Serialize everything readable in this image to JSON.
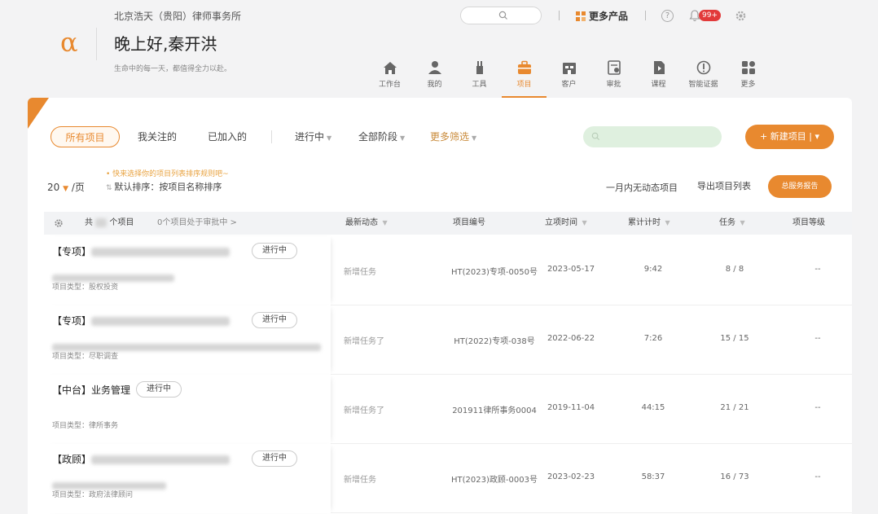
{
  "header": {
    "org": "北京浩天（贵阳）律师事务所",
    "logo": "α",
    "greeting": "晚上好,秦开洪",
    "motto": "生命中的每一天，都值得全力以赴。",
    "more_products": "更多产品",
    "help": "?",
    "notif_count": "99+"
  },
  "nav": [
    {
      "label": "工作台",
      "icon": "home-icon"
    },
    {
      "label": "我的",
      "icon": "user-icon"
    },
    {
      "label": "工具",
      "icon": "tools-icon"
    },
    {
      "label": "项目",
      "icon": "briefcase-icon"
    },
    {
      "label": "客户",
      "icon": "client-icon"
    },
    {
      "label": "审批",
      "icon": "approval-icon"
    },
    {
      "label": "课程",
      "icon": "course-icon"
    },
    {
      "label": "智能证据",
      "icon": "evidence-icon"
    },
    {
      "label": "更多",
      "icon": "more-icon"
    }
  ],
  "filters": {
    "all": "所有项目",
    "followed": "我关注的",
    "joined": "已加入的",
    "status": "进行中",
    "stage": "全部阶段",
    "more": "更多筛选",
    "new_project": "+ 新建项目",
    "per_page_num": "20",
    "per_page_unit": "/页",
    "hint": "• 快来选择你的项目列表排序规则吧~",
    "sort": "默认排序：按项目名称排序",
    "no_activity": "一月内无动态项目",
    "export": "导出项目列表",
    "report": "总服务报告"
  },
  "table": {
    "total_prefix": "共",
    "total_suffix": "个项目",
    "approval": "0个项目处于审批中 >",
    "headers": {
      "dynamic": "最新动态",
      "code": "项目编号",
      "date": "立项时间",
      "time": "累计计时",
      "task": "任务",
      "level": "项目等级"
    },
    "rows": [
      {
        "tag": "【专项】",
        "status": "进行中",
        "type": "项目类型：股权投资",
        "dyn": "新增任务",
        "code": "HT(2023)专项-0050号",
        "date": "2023-05-17",
        "time": "9:42",
        "task": "8 / 8",
        "level": "--"
      },
      {
        "tag": "【专项】",
        "status": "进行中",
        "type": "项目类型：尽职调查",
        "dyn": "新增任务了",
        "code": "HT(2022)专项-038号",
        "date": "2022-06-22",
        "time": "7:26",
        "task": "15 / 15",
        "level": "--"
      },
      {
        "tag": "【中台】业务管理",
        "status": "进行中",
        "type": "项目类型：律所事务",
        "dyn": "新增任务了",
        "code": "201911律所事务0004",
        "date": "2019-11-04",
        "time": "44:15",
        "task": "21 / 21",
        "level": "--"
      },
      {
        "tag": "【政顾】",
        "status": "进行中",
        "type": "项目类型：政府法律顾问",
        "dyn": "新增任务",
        "code": "HT(2023)政顾-0003号",
        "date": "2023-02-23",
        "time": "58:37",
        "task": "16 / 73",
        "level": "--"
      }
    ]
  },
  "colors": {
    "accent": "#e8892f",
    "badge": "#e23a3a"
  }
}
